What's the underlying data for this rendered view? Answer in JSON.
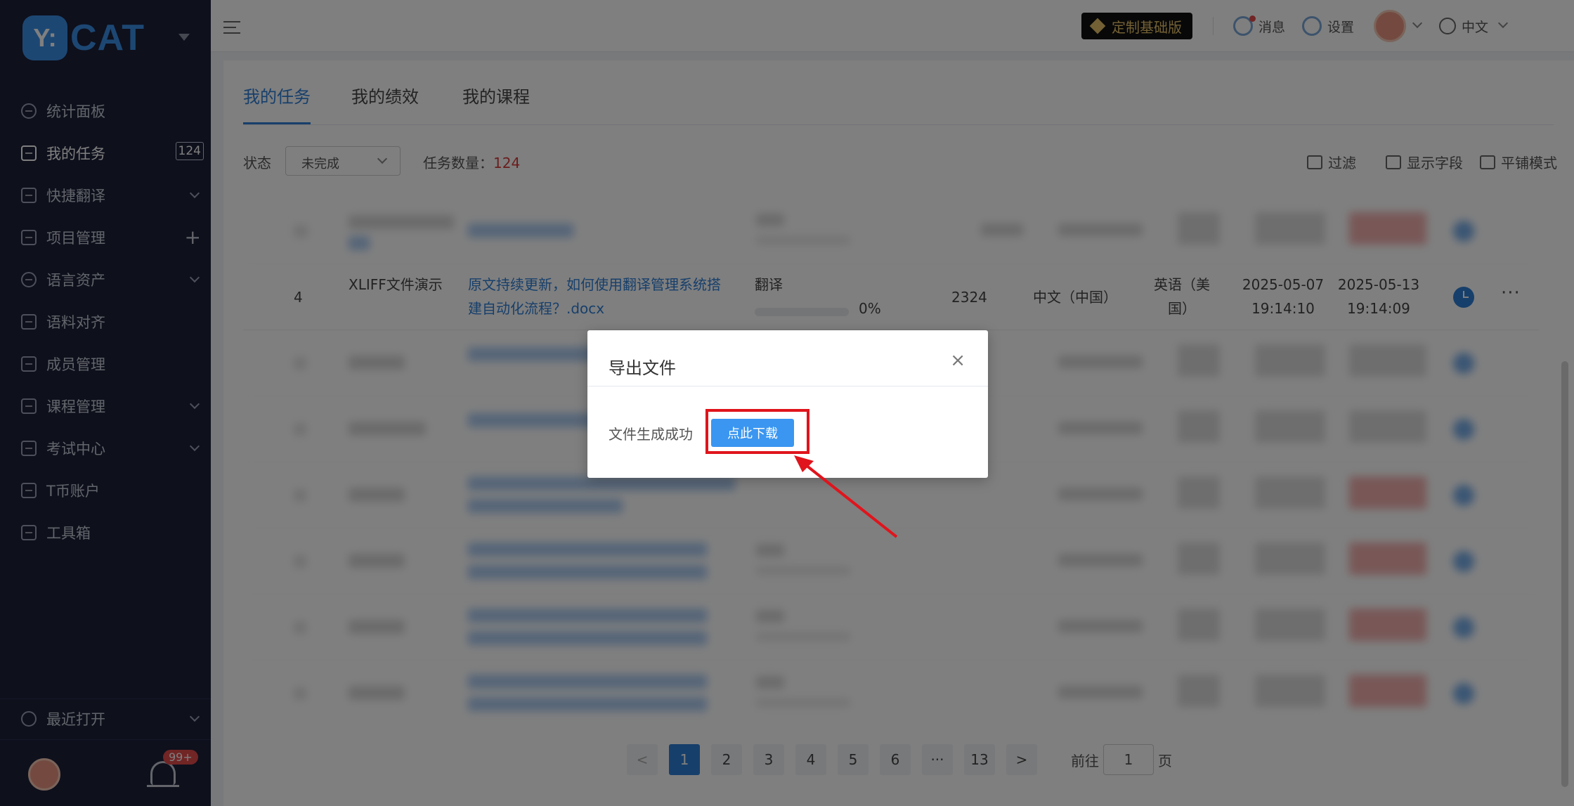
{
  "sidebar": {
    "logo_badge": "Y:",
    "logo_text": "CAT",
    "items": [
      {
        "label": "统计面板"
      },
      {
        "label": "我的任务",
        "count": "124"
      },
      {
        "label": "快捷翻译"
      },
      {
        "label": "项目管理"
      },
      {
        "label": "语言资产"
      },
      {
        "label": "语料对齐"
      },
      {
        "label": "成员管理"
      },
      {
        "label": "课程管理"
      },
      {
        "label": "考试中心"
      },
      {
        "label": "T币账户"
      },
      {
        "label": "工具箱"
      }
    ],
    "recent_label": "最近打开",
    "notification_badge": "99+"
  },
  "topbar": {
    "edition_label": "定制基础版",
    "messages_label": "消息",
    "settings_label": "设置",
    "language_label": "中文"
  },
  "tabs": [
    {
      "label": "我的任务"
    },
    {
      "label": "我的绩效"
    },
    {
      "label": "我的课程"
    }
  ],
  "filter": {
    "status_label": "状态",
    "status_value": "未完成",
    "count_label": "任务数量：",
    "count_value": "124",
    "filter_label": "过滤",
    "fields_label": "显示字段",
    "tile_label": "平铺模式"
  },
  "task_row": {
    "index": "4",
    "project": "XLIFF文件演示",
    "file_line1": "原文持续更新，如何使用翻译管理系统搭",
    "file_line2": "建自动化流程？.docx",
    "stage": "翻译",
    "progress": "0%",
    "words": "2324",
    "source_lang": "中文（中国）",
    "target_lang_line1": "英语（美",
    "target_lang_line2": "国）",
    "start_date": "2025-05-07",
    "start_time": "19:14:10",
    "due_date": "2025-05-13",
    "due_time": "19:14:09",
    "more": "···"
  },
  "pagination": {
    "pages": [
      "1",
      "2",
      "3",
      "4",
      "5",
      "6",
      "···",
      "13"
    ],
    "prev": "<",
    "next": ">",
    "goto_label": "前往",
    "goto_value": "1",
    "page_suffix": "页"
  },
  "modal": {
    "title": "导出文件",
    "close": "×",
    "message": "文件生成成功",
    "download_label": "点此下载"
  },
  "colors": {
    "accent": "#2f7fd6",
    "sidebar_bg": "#1c2038",
    "highlight": "#e0141c"
  }
}
